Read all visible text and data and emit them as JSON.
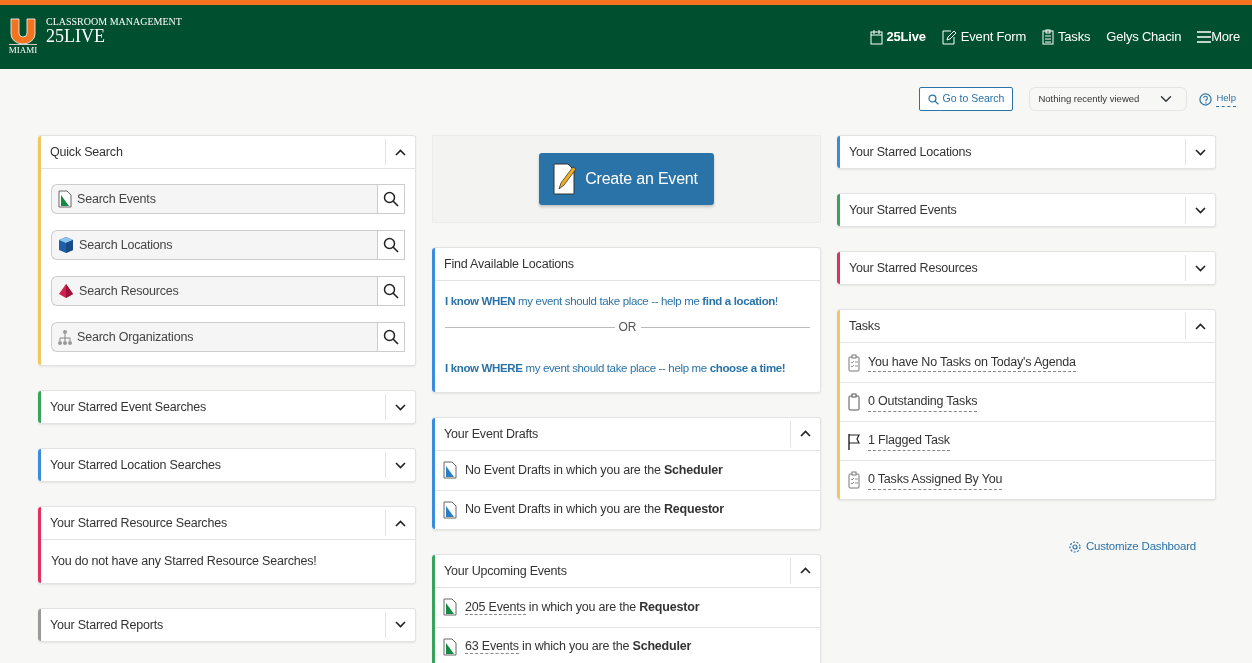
{
  "header": {
    "logo_mark": "MIAMI",
    "subtitle": "CLASSROOM MANAGEMENT",
    "title": "25LIVE",
    "nav": [
      {
        "label": "25Live",
        "kind": "calendar",
        "selected": true
      },
      {
        "label": "Event Form",
        "kind": "form",
        "selected": false
      },
      {
        "label": "Tasks",
        "kind": "tasks",
        "selected": false
      },
      {
        "label": "Gelys Chacin",
        "kind": "user",
        "selected": false
      },
      {
        "label": "More",
        "kind": "menu",
        "selected": false
      }
    ]
  },
  "toolbar": {
    "search_button": "Go to Search",
    "recent": "Nothing recently viewed",
    "help": "Help"
  },
  "columns": [
    [
      {
        "kind": "quick_search",
        "title": "Quick Search",
        "color": "#f0c75e",
        "expanded": true,
        "fields": [
          {
            "kind": "event",
            "placeholder": "Search Events"
          },
          {
            "kind": "location",
            "placeholder": "Search Locations"
          },
          {
            "kind": "resource",
            "placeholder": "Search Resources"
          },
          {
            "kind": "organization",
            "placeholder": "Search Organizations"
          }
        ]
      },
      {
        "kind": "list",
        "title": "Your Starred Event Searches",
        "color": "#3aa35b",
        "expanded": false
      },
      {
        "kind": "list",
        "title": "Your Starred Location Searches",
        "color": "#3b8ddb",
        "expanded": false
      },
      {
        "kind": "list",
        "title": "Your Starred Resource Searches",
        "color": "#e0325f",
        "expanded": true,
        "message": "You do not have any Starred Resource Searches!"
      },
      {
        "kind": "list",
        "title": "Your Starred Reports",
        "color": "#9a9a9a",
        "expanded": false
      }
    ],
    [
      {
        "kind": "create",
        "label": "Create an Event"
      },
      {
        "kind": "find",
        "title": "Find Available Locations",
        "color": "#3b8ddb",
        "lines": [
          "**I know WHEN** my event should take place -- help me **find a location**!",
          "**I know WHERE** my event should take place -- help me **choose a time!**"
        ],
        "divider": "OR"
      },
      {
        "kind": "list",
        "title": "Your Event Drafts",
        "color": "#3b8ddb",
        "expanded": true,
        "items": [
          {
            "kind": "draft",
            "text": "No Event Drafts in which you are the **Scheduler**"
          },
          {
            "kind": "draft",
            "text": "No Event Drafts in which you are the **Requestor**"
          }
        ]
      },
      {
        "kind": "list",
        "title": "Your Upcoming Events",
        "color": "#3aa35b",
        "expanded": true,
        "items": [
          {
            "kind": "event",
            "link": "205 Events",
            "text": "in which you are the **Requestor**"
          },
          {
            "kind": "event",
            "link": "63 Events",
            "text": "in which you are the **Scheduler**"
          }
        ]
      }
    ],
    [
      {
        "kind": "list",
        "title": "Your Starred Locations",
        "color": "#3b8ddb",
        "expanded": false
      },
      {
        "kind": "list",
        "title": "Your Starred Events",
        "color": "#3aa35b",
        "expanded": false
      },
      {
        "kind": "list",
        "title": "Your Starred Resources",
        "color": "#e0325f",
        "expanded": false
      },
      {
        "kind": "list",
        "title": "Tasks",
        "color": "#f0c75e",
        "expanded": true,
        "items": [
          {
            "kind": "checklist",
            "link": "You have No Tasks on Today's Agenda"
          },
          {
            "kind": "clipboard",
            "link": "0 Outstanding Tasks"
          },
          {
            "kind": "flag",
            "link": "1 Flagged Task"
          },
          {
            "kind": "checklist",
            "link": "0 Tasks Assigned By You"
          }
        ]
      },
      {
        "kind": "customize",
        "label": "Customize Dashboard"
      }
    ]
  ]
}
